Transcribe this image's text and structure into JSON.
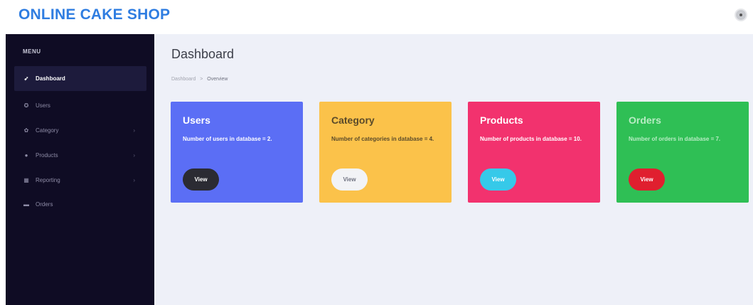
{
  "header": {
    "brand": "ONLINE CAKE SHOP"
  },
  "sidebar": {
    "heading": "MENU",
    "items": [
      {
        "label": "Dashboard",
        "icon": "rocket-icon",
        "glyph": "➶",
        "active": true,
        "has_children": false
      },
      {
        "label": "Users",
        "icon": "user-icon",
        "glyph": "✪",
        "active": false,
        "has_children": false
      },
      {
        "label": "Category",
        "icon": "settings-icon",
        "glyph": "✿",
        "active": false,
        "has_children": true
      },
      {
        "label": "Products",
        "icon": "box-icon",
        "glyph": "●",
        "active": false,
        "has_children": true
      },
      {
        "label": "Reporting",
        "icon": "bank-icon",
        "glyph": "▦",
        "active": false,
        "has_children": true
      },
      {
        "label": "Orders",
        "icon": "cart-icon",
        "glyph": "▬",
        "active": false,
        "has_children": false
      }
    ],
    "chevron": "›"
  },
  "main": {
    "title": "Dashboard",
    "breadcrumb": {
      "root": "Dashboard",
      "separator": ">",
      "current": "Overview"
    },
    "cards": [
      {
        "title": "Users",
        "text": "Number of users in database = 2.",
        "button": "View",
        "bg": "#5b6ef5",
        "fg": "#ffffff",
        "btn_bg": "#2b2b33",
        "btn_fg": "#ffffff"
      },
      {
        "title": "Category",
        "text": "Number of categories in database = 4.",
        "button": "View",
        "bg": "#fbc24a",
        "fg": "#5a4a2a",
        "btn_bg": "#f2f3f6",
        "btn_fg": "#6f7280"
      },
      {
        "title": "Products",
        "text": "Number of products in database = 10.",
        "button": "View",
        "bg": "#f2326e",
        "fg": "#ffffff",
        "btn_bg": "#36c9e9",
        "btn_fg": "#ffffff"
      },
      {
        "title": "Orders",
        "text": "Number of orders in database = 7.",
        "button": "View",
        "bg": "#2fbf55",
        "fg": "#b8ecc4",
        "btn_bg": "#e01f2f",
        "btn_fg": "#ffffff"
      }
    ]
  },
  "colors": {
    "brand": "#2f7de1",
    "sidebar_bg": "#0f0c24",
    "main_bg": "#eef0f8"
  }
}
